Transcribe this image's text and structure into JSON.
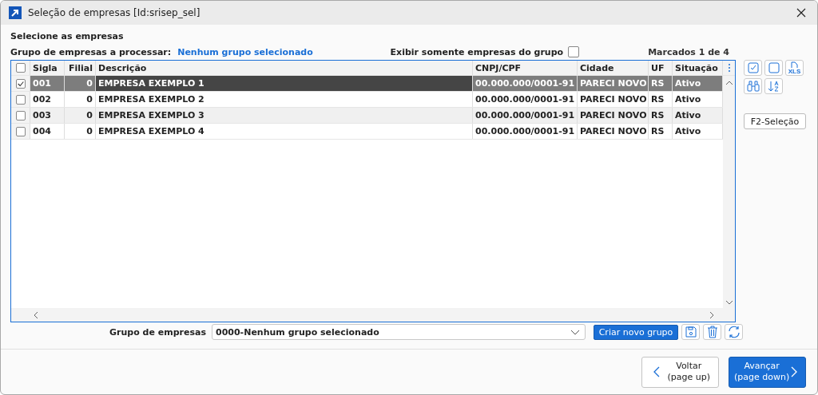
{
  "window": {
    "title": "Seleção de empresas [Id:srisep_sel]"
  },
  "heading": "Selecione as empresas",
  "group_line": {
    "label": "Grupo de empresas a processar:",
    "value": "Nenhum grupo selecionado"
  },
  "filter": {
    "label": "Exibir somente empresas do grupo",
    "checked": false
  },
  "counter": "Marcados 1 de 4",
  "table": {
    "all_checked": false,
    "columns": [
      "Sigla",
      "Filial",
      "Descrição",
      "CNPJ/CPF",
      "Cidade",
      "UF",
      "Situação"
    ],
    "rows": [
      {
        "selected": true,
        "checked": true,
        "cells": [
          "001",
          "0",
          "EMPRESA EXEMPLO 1",
          "00.000.000/0001-91",
          "PARECI NOVO",
          "RS",
          "Ativo"
        ]
      },
      {
        "selected": false,
        "checked": false,
        "cells": [
          "002",
          "0",
          "EMPRESA EXEMPLO 2",
          "00.000.000/0001-91",
          "PARECI NOVO",
          "RS",
          "Ativo"
        ]
      },
      {
        "selected": false,
        "checked": false,
        "cells": [
          "003",
          "0",
          "EMPRESA EXEMPLO 3",
          "00.000.000/0001-91",
          "PARECI NOVO",
          "RS",
          "Ativo"
        ]
      },
      {
        "selected": false,
        "checked": false,
        "cells": [
          "004",
          "0",
          "EMPRESA EXEMPLO 4",
          "00.000.000/0001-91",
          "PARECI NOVO",
          "RS",
          "Ativo"
        ]
      }
    ]
  },
  "export_icon_text": "XLS",
  "selection_button": "F2-Seleção",
  "group_select": {
    "label": "Grupo de empresas",
    "value": "0000-Nenhum grupo selecionado"
  },
  "create_button": "Criar novo grupo",
  "footer_buttons": [
    {
      "kind": "back",
      "label": "Voltar",
      "sublabel": "(page up)"
    },
    {
      "kind": "next",
      "label": "Avançar",
      "sublabel": "(page down)"
    }
  ]
}
